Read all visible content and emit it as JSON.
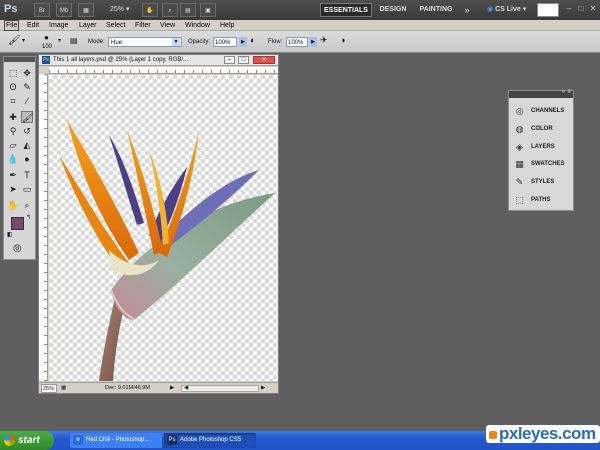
{
  "app": {
    "logo": "Ps",
    "zoom_dropdown": "25%",
    "workspaces": {
      "essentials": "ESSENTIALS",
      "design": "DESIGN",
      "painting": "PAINTING",
      "more": "»"
    },
    "cs_live": "CS Live",
    "window_controls": {
      "minimize": "–",
      "maximize": "□",
      "close": "✕"
    }
  },
  "menu": [
    "File",
    "Edit",
    "Image",
    "Layer",
    "Select",
    "Filter",
    "View",
    "Window",
    "Help"
  ],
  "options": {
    "brush_size": "100",
    "mode_label": "Mode:",
    "mode_value": "Hue",
    "opacity_label": "Opacity:",
    "opacity_value": "100%",
    "flow_label": "Flow:",
    "flow_value": "100%"
  },
  "document": {
    "title": "This 1 all layers.psd @ 25% (Layer 1 copy, RGB/...",
    "zoom": "25%",
    "doc_info": "Doc: 9.01M/46.9M"
  },
  "panels": [
    {
      "label": "CHANNELS",
      "icon": "channels-icon"
    },
    {
      "label": "COLOR",
      "icon": "color-icon"
    },
    {
      "label": "LAYERS",
      "icon": "layers-icon"
    },
    {
      "label": "SWATCHES",
      "icon": "swatches-icon"
    },
    {
      "label": "STYLES",
      "icon": "styles-icon"
    },
    {
      "label": "PATHS",
      "icon": "paths-icon"
    }
  ],
  "colors": {
    "foreground": "#7a4a6a",
    "background": "#000000",
    "accent": "#2457cf"
  },
  "taskbar": {
    "start": "start",
    "tasks": [
      "Red Chili - Photoshop...",
      "Adobe Photoshop CS5"
    ]
  },
  "watermark": "pxleyes.com"
}
